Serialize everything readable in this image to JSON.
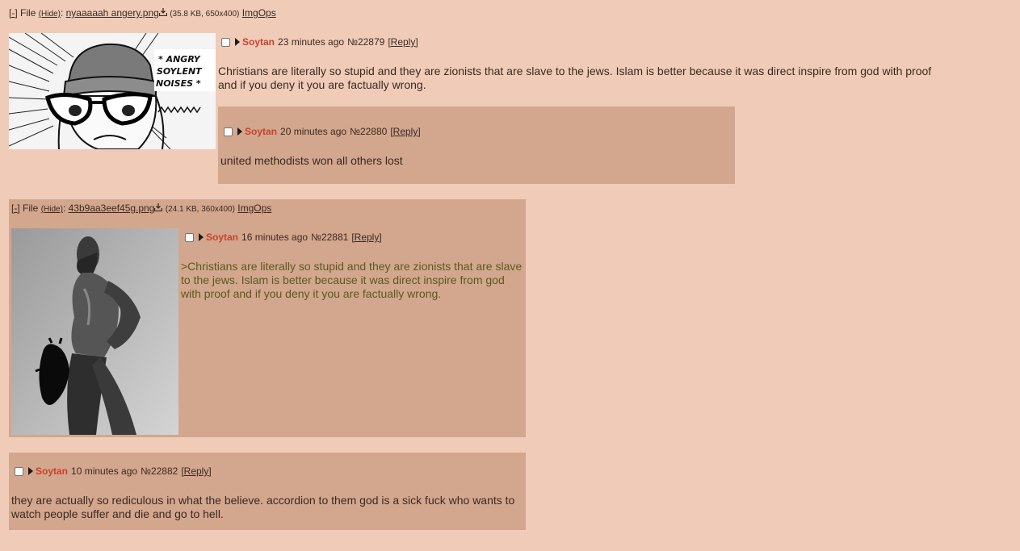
{
  "op": {
    "file": {
      "toggle": "[-]",
      "label": "File",
      "hide": "(Hide)",
      "separator": ":",
      "filename": "nyaaaaah angery.png",
      "download_icon": "download-icon",
      "size": "(35.8 KB, 650x400)",
      "imgops": "ImgOps"
    },
    "thumb_text": [
      "* ANGRY",
      "SOYLENT",
      "NOISES *"
    ],
    "author": "Soytan",
    "time": "23 minutes ago",
    "post_no": "№22879",
    "reply": "[Reply]",
    "message": "Christians are literally so stupid and they are zionists that are slave to the jews. Islam is better because it was direct inspire from god with proof and if you deny it you are factually wrong."
  },
  "replies": [
    {
      "author": "Soytan",
      "time": "20 minutes ago",
      "post_no": "№22880",
      "reply": "[Reply]",
      "message": "united methodists won all others lost"
    },
    {
      "file": {
        "toggle": "[-]",
        "label": "File",
        "hide": "(Hide)",
        "separator": ":",
        "filename": "43b9aa3eef45g.png",
        "download_icon": "download-icon",
        "size": "(24.1 KB, 360x400)",
        "imgops": "ImgOps"
      },
      "author": "Soytan",
      "time": "16 minutes ago",
      "post_no": "№22881",
      "reply": "[Reply]",
      "message": ">Christians are literally so stupid and they are zionists that are slave to the jews. Islam is better because it was direct inspire from god with proof and if you deny it you are factually wrong."
    },
    {
      "author": "Soytan",
      "time": "10 minutes ago",
      "post_no": "№22882",
      "reply": "[Reply]",
      "message": "they are actually so rediculous in what the believe. accordion to them god is a sick fuck who wants to watch people suffer and die and go to hell."
    }
  ],
  "colors": {
    "background": "#f0cbb8",
    "reply_background": "#d3a68e",
    "name": "#c8432b",
    "quote": "#5b5a20"
  }
}
